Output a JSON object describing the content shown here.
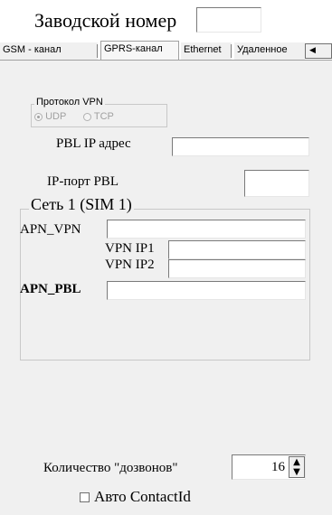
{
  "header": {
    "serial_label": "Заводской номер",
    "serial_value": ""
  },
  "tabs": [
    {
      "label": "GSM - канал"
    },
    {
      "label": "GPRS-канал"
    },
    {
      "label": "Ethernet"
    },
    {
      "label": "Удаленное"
    }
  ],
  "vpn_protocol": {
    "group_label": "Протокол VPN",
    "options": [
      "UDP",
      "TCP"
    ],
    "selected": "UDP"
  },
  "pbl": {
    "ip_label": "PBL IP адрес",
    "ip_value": "",
    "port_label": "IP-порт PBL",
    "port_value": ""
  },
  "network1": {
    "group_label": "Сеть 1 (SIM 1)",
    "apn_vpn_label": "APN_VPN",
    "apn_vpn_value": "",
    "vpn_ip1_label": "VPN IP1",
    "vpn_ip1_value": "",
    "vpn_ip2_label": "VPN IP2",
    "vpn_ip2_value": "",
    "apn_pbl_label": "APN_PBL",
    "apn_pbl_value": ""
  },
  "redial": {
    "label": "Количество \"дозвонов\"",
    "value": "16"
  },
  "auto_contact": {
    "label": "Авто ContactId",
    "checked": false
  }
}
